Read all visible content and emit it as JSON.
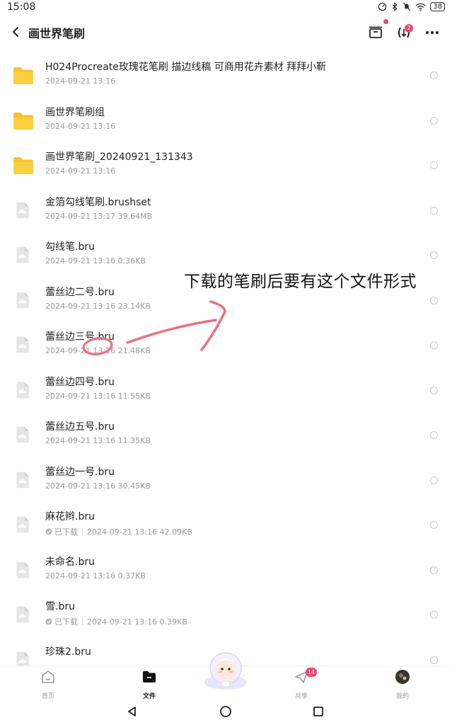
{
  "status_bar": {
    "time": "15:08",
    "battery": "38"
  },
  "header": {
    "title": "画世界笔刷",
    "notification_badge": "2"
  },
  "files": [
    {
      "type": "folder",
      "name": "H024Procreate玫瑰花笔刷 描边线稿 可商用花卉素材 拜拜小靳",
      "meta": "2024-09-21  13:16",
      "downloaded": false
    },
    {
      "type": "folder",
      "name": "画世界笔刷组",
      "meta": "2024-09-21  13:16",
      "downloaded": false
    },
    {
      "type": "folder",
      "name": "画世界笔刷_20240921_131343",
      "meta": "2024-09-21  13:16",
      "downloaded": false
    },
    {
      "type": "file",
      "name": "金箔勾线笔刷.brushset",
      "meta": "2024-09-21  13:17  39.64MB",
      "downloaded": false
    },
    {
      "type": "file",
      "name": "勾线笔.bru",
      "meta": "2024-09-21  13:16  0.36KB",
      "downloaded": false
    },
    {
      "type": "file",
      "name": "蕾丝边二号.bru",
      "meta": "2024-09-21  13:16  23.14KB",
      "downloaded": false
    },
    {
      "type": "file",
      "name": "蕾丝边三号.bru",
      "meta": "2024-09-21  13:16  21.48KB",
      "downloaded": false
    },
    {
      "type": "file",
      "name": "蕾丝边四号.bru",
      "meta": "2024-09-21  13:16  11.55KB",
      "downloaded": false
    },
    {
      "type": "file",
      "name": "蕾丝边五号.bru",
      "meta": "2024-09-21  13:16  11.35KB",
      "downloaded": false
    },
    {
      "type": "file",
      "name": "蕾丝边一号.bru",
      "meta": "2024-09-21  13:16  30.45KB",
      "downloaded": false
    },
    {
      "type": "file",
      "name": "麻花辫.bru",
      "meta": "2024-09-21  13:16  42.09KB",
      "downloaded": true
    },
    {
      "type": "file",
      "name": "未命名.bru",
      "meta": "2024-09-21  13:16  0.37KB",
      "downloaded": false
    },
    {
      "type": "file",
      "name": "雪.bru",
      "meta": "2024-09-21  13:16  0.39KB",
      "downloaded": true
    },
    {
      "type": "file",
      "name": "珍珠2.bru",
      "meta": "",
      "downloaded": false
    }
  ],
  "downloaded_label": "已下载",
  "annotation": {
    "text": "下载的笔刷后要有这个文件形式"
  },
  "bottom_nav": {
    "home": "首页",
    "files": "文件",
    "share": "共享",
    "share_badge": "14",
    "mine": "我的"
  },
  "colors": {
    "accent_red": "#e8486a",
    "folder_yellow": "#f7c32b",
    "annotation_pink": "#ec6f7d"
  }
}
